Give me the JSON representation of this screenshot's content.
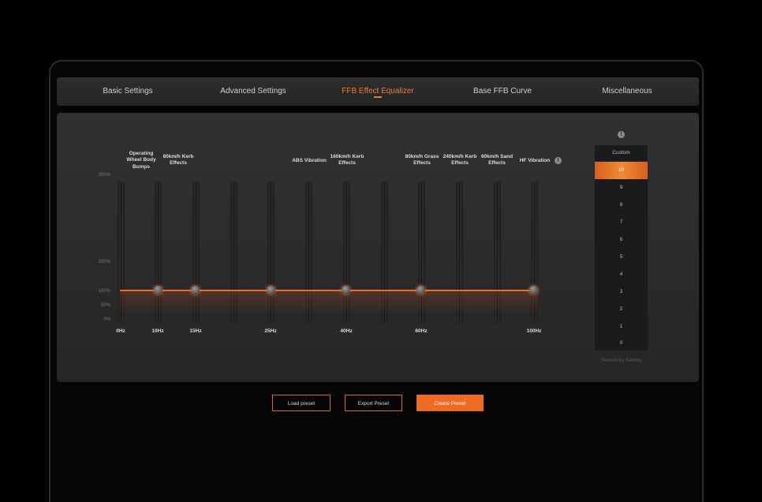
{
  "tabs": [
    {
      "label": "Basic Settings",
      "active": false
    },
    {
      "label": "Advanced Settings",
      "active": false
    },
    {
      "label": "FFB Effect Equalizer",
      "active": true
    },
    {
      "label": "Base FFB Curve",
      "active": false
    },
    {
      "label": "Miscellaneous",
      "active": false
    }
  ],
  "equalizer": {
    "y_labels": [
      "300%",
      "200%",
      "100%",
      "50%",
      "0%"
    ],
    "band_labels": [
      "Operating Wheel Body Bumps",
      "80km/h Kerb Effects",
      "ABS Vibration",
      "160km/h Kerb Effects",
      "80km/h Grass Effects",
      "240km/h Kerb Effects",
      "60km/h Sand Effects",
      "HF Vibration"
    ],
    "freq_labels": [
      "0Hz",
      "10Hz",
      "15Hz",
      "25Hz",
      "40Hz",
      "60Hz",
      "100Hz"
    ],
    "line_level": "100%",
    "knob_values_percent": [
      100,
      100,
      100,
      100,
      100,
      100
    ],
    "accent_color": "#ef7a2c"
  },
  "sensitivity": {
    "header": "Custom",
    "options": [
      "10",
      "9",
      "8",
      "7",
      "6",
      "5",
      "4",
      "3",
      "2",
      "1",
      "0"
    ],
    "selected": "10",
    "caption": "Sensitivity Setting"
  },
  "buttons": {
    "load": "Load preset",
    "export": "Export Preset",
    "create": "Create Preset"
  }
}
